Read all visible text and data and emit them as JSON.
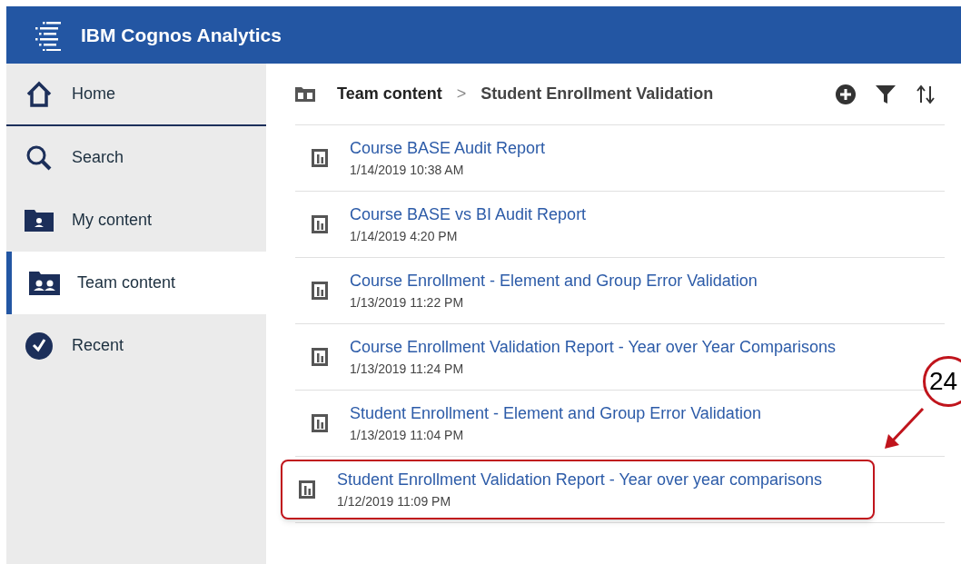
{
  "header": {
    "title": "IBM Cognos Analytics"
  },
  "sidebar": {
    "items": [
      {
        "label": "Home",
        "selected": false
      },
      {
        "label": "Search",
        "selected": false
      },
      {
        "label": "My content",
        "selected": false
      },
      {
        "label": "Team content",
        "selected": true
      },
      {
        "label": "Recent",
        "selected": false
      }
    ]
  },
  "breadcrumb": {
    "root": "Team content",
    "separator": ">",
    "current": "Student Enrollment Validation"
  },
  "reports": [
    {
      "name": "Course BASE Audit Report",
      "modified": "1/14/2019 10:38 AM",
      "highlighted": false
    },
    {
      "name": "Course BASE vs BI Audit Report",
      "modified": "1/14/2019 4:20 PM",
      "highlighted": false
    },
    {
      "name": "Course Enrollment - Element and Group Error Validation",
      "modified": "1/13/2019 11:22 PM",
      "highlighted": false
    },
    {
      "name": "Course Enrollment Validation Report - Year over Year Comparisons",
      "modified": "1/13/2019 11:24 PM",
      "highlighted": false
    },
    {
      "name": "Student Enrollment - Element and Group Error Validation",
      "modified": "1/13/2019 11:04 PM",
      "highlighted": false
    },
    {
      "name": "Student Enrollment Validation Report - Year over year comparisons",
      "modified": "1/12/2019 11:09 PM",
      "highlighted": true
    }
  ],
  "callout": {
    "number": "24"
  }
}
